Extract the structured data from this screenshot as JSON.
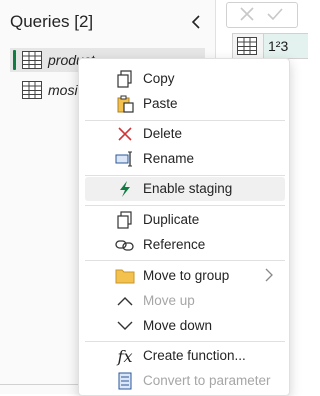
{
  "queries_pane": {
    "title": "Queries [2]",
    "items": [
      {
        "name": "product",
        "selected": true
      },
      {
        "name": "mosic",
        "selected": false
      }
    ]
  },
  "grid": {
    "type_label": "1²3"
  },
  "context_menu": {
    "items": [
      {
        "label": "Copy",
        "icon": "copy-icon",
        "enabled": true
      },
      {
        "label": "Paste",
        "icon": "paste-icon",
        "enabled": true
      },
      {
        "label": "Delete",
        "icon": "delete-icon",
        "enabled": true
      },
      {
        "label": "Rename",
        "icon": "rename-icon",
        "enabled": true
      },
      {
        "label": "Enable staging",
        "icon": "staging-icon",
        "enabled": true
      },
      {
        "label": "Duplicate",
        "icon": "duplicate-icon",
        "enabled": true
      },
      {
        "label": "Reference",
        "icon": "reference-icon",
        "enabled": true
      },
      {
        "label": "Move to group",
        "icon": "folder-icon",
        "enabled": true,
        "has_submenu": true
      },
      {
        "label": "Move up",
        "icon": "chevron-up-icon",
        "enabled": false
      },
      {
        "label": "Move down",
        "icon": "chevron-down-icon",
        "enabled": true
      },
      {
        "label": "Create function...",
        "icon": "function-icon",
        "enabled": true
      },
      {
        "label": "Convert to parameter",
        "icon": "parameter-icon",
        "enabled": false
      }
    ]
  },
  "colors": {
    "accent_green": "#107c41",
    "delete_red": "#d13438",
    "folder_yellow": "#f2c14e",
    "icon_blue": "#2b579a"
  }
}
